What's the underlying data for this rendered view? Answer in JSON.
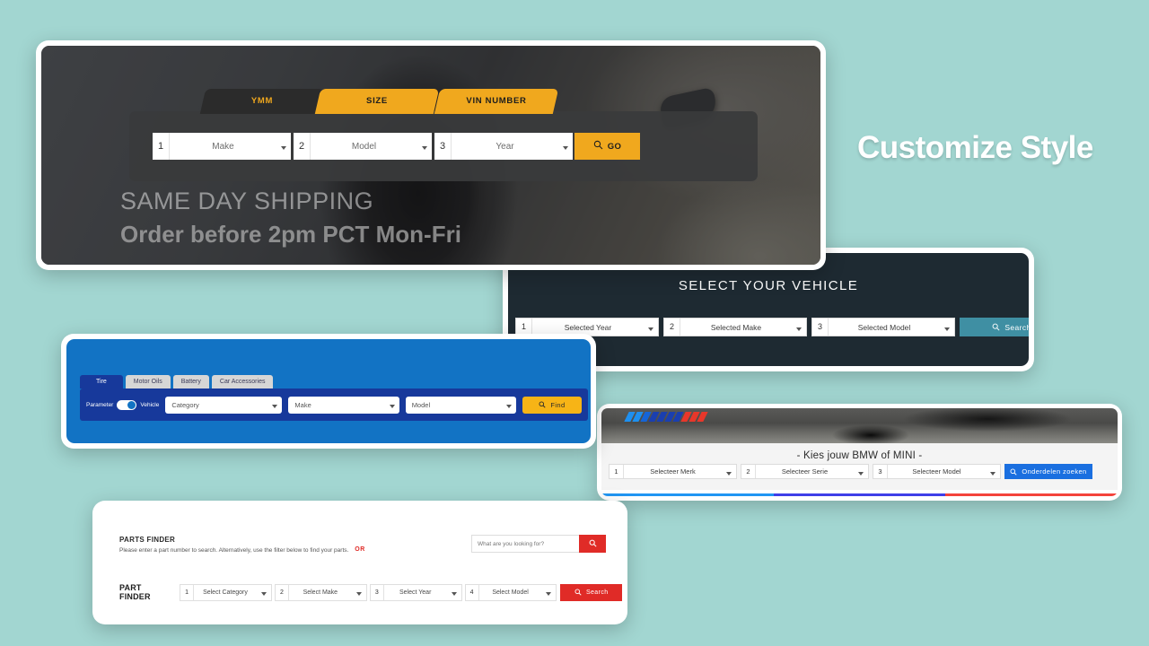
{
  "background_color": "#a2d6d1",
  "headline": "Customize Style",
  "card1": {
    "name": "ymm-hero-widget",
    "tabs": [
      {
        "label": "YMM",
        "active": true
      },
      {
        "label": "SIZE",
        "active": false
      },
      {
        "label": "VIN NUMBER",
        "active": false
      }
    ],
    "selects": [
      {
        "num": "1",
        "value": "Make"
      },
      {
        "num": "2",
        "value": "Model"
      },
      {
        "num": "3",
        "value": "Year"
      }
    ],
    "button": {
      "label": "GO",
      "icon": "search-icon",
      "color": "#f0a81e"
    },
    "hero_line1": "SAME DAY SHIPPING",
    "hero_line2": "Order before 2pm PCT Mon-Fri"
  },
  "card2": {
    "name": "select-your-vehicle-widget",
    "title": "SELECT YOUR VEHICLE",
    "selects": [
      {
        "num": "1",
        "value": "Selected Year"
      },
      {
        "num": "2",
        "value": "Selected Make"
      },
      {
        "num": "3",
        "value": "Selected Model"
      }
    ],
    "button": {
      "label": "Search",
      "icon": "search-icon",
      "color": "#3f8fa3"
    },
    "background_color": "#1e2a32"
  },
  "card3": {
    "name": "tire-finder-widget",
    "tabs": [
      {
        "label": "Tire",
        "active": true
      },
      {
        "label": "Motor Oils",
        "active": false
      },
      {
        "label": "Battery",
        "active": false
      },
      {
        "label": "Car Accessories",
        "active": false
      }
    ],
    "toggle_left_label": "Parameter",
    "toggle_right_label": "Vehicle",
    "selects": [
      {
        "value": "Category"
      },
      {
        "value": "Make"
      },
      {
        "value": "Model"
      }
    ],
    "button": {
      "label": "Find",
      "icon": "search-icon",
      "color": "#f7b416"
    },
    "background_color": "#1273c4",
    "panel_color": "#17399b"
  },
  "card4": {
    "name": "bmw-mini-finder-widget",
    "title": "- Kies jouw BMW of MINI -",
    "selects": [
      {
        "num": "1",
        "value": "Selecteer Merk"
      },
      {
        "num": "2",
        "value": "Selecteer Serie"
      },
      {
        "num": "3",
        "value": "Selecteer Model"
      }
    ],
    "button": {
      "label": "Onderdelen zoeken",
      "icon": "search-icon",
      "color": "#1a6fe0"
    },
    "stripe_colors": [
      "#1e90f0",
      "#1e90f0",
      "#1565d8",
      "#1a3fb0",
      "#1a3fb0",
      "#1a3fb0",
      "#1a3fb0",
      "#e8372a",
      "#e8372a",
      "#e8372a"
    ],
    "footer_bar_colors": [
      "#2196f3",
      "#3f3fe8",
      "#f4433b"
    ]
  },
  "card5": {
    "name": "parts-finder-widget",
    "title": "PARTS FINDER",
    "description": "Please enter a part number to search. Alternatively, use the filter below to find your parts.",
    "search_placeholder": "What are you looking for?",
    "or_label": "OR",
    "row_label": "PART FINDER",
    "selects": [
      {
        "num": "1",
        "value": "Select Category"
      },
      {
        "num": "2",
        "value": "Select Make"
      },
      {
        "num": "3",
        "value": "Select Year"
      },
      {
        "num": "4",
        "value": "Select Model"
      }
    ],
    "button": {
      "label": "Search",
      "icon": "search-icon",
      "color": "#e02b27"
    }
  }
}
